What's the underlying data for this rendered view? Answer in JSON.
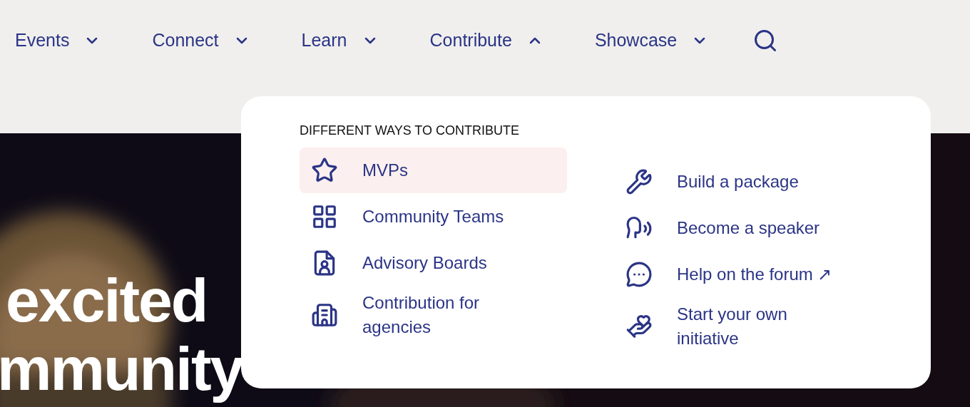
{
  "nav": [
    {
      "label": "Events",
      "expanded": false
    },
    {
      "label": "Connect",
      "expanded": false
    },
    {
      "label": "Learn",
      "expanded": false
    },
    {
      "label": "Contribute",
      "expanded": true
    },
    {
      "label": "Showcase",
      "expanded": false
    }
  ],
  "hero": {
    "kind": "picture",
    "headline": [
      "excited",
      "mmunity"
    ]
  },
  "dropdown": {
    "heading": "DIFFERENT WAYS TO CONTRIBUTE",
    "columns": [
      [
        {
          "label": "MVPs",
          "selected": true
        },
        {
          "label": "Community Teams",
          "selected": false
        },
        {
          "label": "Advisory Boards",
          "selected": false
        },
        {
          "label": "Contribution for agencies",
          "selected": false
        }
      ],
      [
        {
          "label": "Build a package",
          "selected": false
        },
        {
          "label": "Become a speaker",
          "selected": false
        },
        {
          "label": "Help on the forum ↗",
          "selected": false
        },
        {
          "label": "Start your own initiative",
          "selected": false
        }
      ]
    ]
  }
}
